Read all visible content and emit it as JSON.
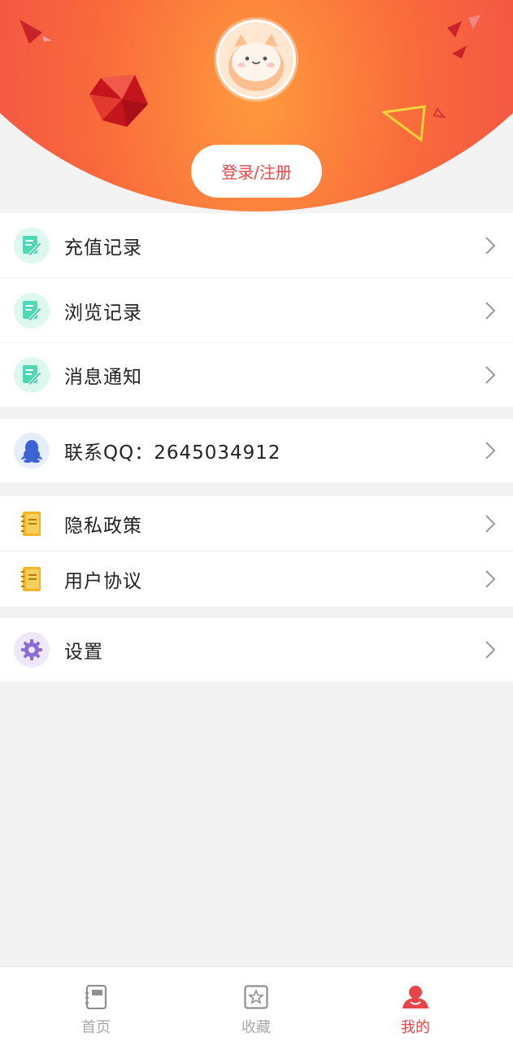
{
  "header": {
    "login_label": "登录/注册"
  },
  "groups": [
    {
      "items": [
        {
          "label": "充值记录",
          "icon": "edit-note-icon"
        },
        {
          "label": "浏览记录",
          "icon": "edit-note-icon"
        },
        {
          "label": "消息通知",
          "icon": "edit-note-icon"
        }
      ]
    },
    {
      "items": [
        {
          "label": "联系QQ：2645034912",
          "icon": "qq-penguin-icon"
        }
      ]
    },
    {
      "items": [
        {
          "label": "隐私政策",
          "icon": "notebook-icon"
        },
        {
          "label": "用户协议",
          "icon": "notebook-icon"
        }
      ]
    },
    {
      "items": [
        {
          "label": "设置",
          "icon": "gear-icon"
        }
      ]
    }
  ],
  "tabbar": {
    "tabs": [
      {
        "label": "首页",
        "icon": "book-icon",
        "active": false
      },
      {
        "label": "收藏",
        "icon": "star-box-icon",
        "active": false
      },
      {
        "label": "我的",
        "icon": "user-icon",
        "active": true
      }
    ]
  },
  "colors": {
    "accent": "#e8454a",
    "header_red": "#ee3f47",
    "header_orange": "#ff9a3d",
    "mint": "#4fd8b4",
    "qq_blue": "#3b63d6",
    "notebook_yellow": "#f2b526",
    "gear_purple": "#8a6bd8"
  }
}
